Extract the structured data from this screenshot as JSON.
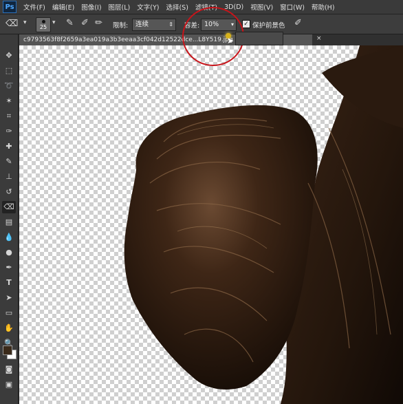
{
  "app": {
    "logo": "Ps"
  },
  "menubar": {
    "items": [
      "文件(F)",
      "编辑(E)",
      "图像(I)",
      "图层(L)",
      "文字(Y)",
      "选择(S)",
      "滤镜(T)",
      "3D(D)",
      "视图(V)",
      "窗口(W)",
      "帮助(H)"
    ]
  },
  "options": {
    "brush_size": "25",
    "limit_label": "限制:",
    "limit_value": "连续",
    "tolerance_label": "容差:",
    "tolerance_value": "10%",
    "protect_fg_label": "保护前景色",
    "protect_fg_checked": true
  },
  "document": {
    "tab_title": "c9793563f8f2659a3ea019a3b3eeaa3cf042d12522dce...L8Y519.jpg",
    "close_symbol": "×"
  },
  "tools": [
    "move-tool-icon",
    "marquee-tool-icon",
    "lasso-tool-icon",
    "magic-wand-icon",
    "crop-tool-icon",
    "eyedropper-icon",
    "healing-brush-icon",
    "brush-tool-icon",
    "clone-stamp-icon",
    "history-brush-icon",
    "background-eraser-icon",
    "gradient-tool-icon",
    "blur-tool-icon",
    "dodge-tool-icon",
    "pen-tool-icon",
    "type-tool-icon",
    "path-selection-icon",
    "shape-tool-icon",
    "hand-tool-icon",
    "zoom-tool-icon"
  ],
  "colors": {
    "foreground": "#3a2a1a",
    "background": "#ffffff",
    "annotation": "#c8141a"
  }
}
